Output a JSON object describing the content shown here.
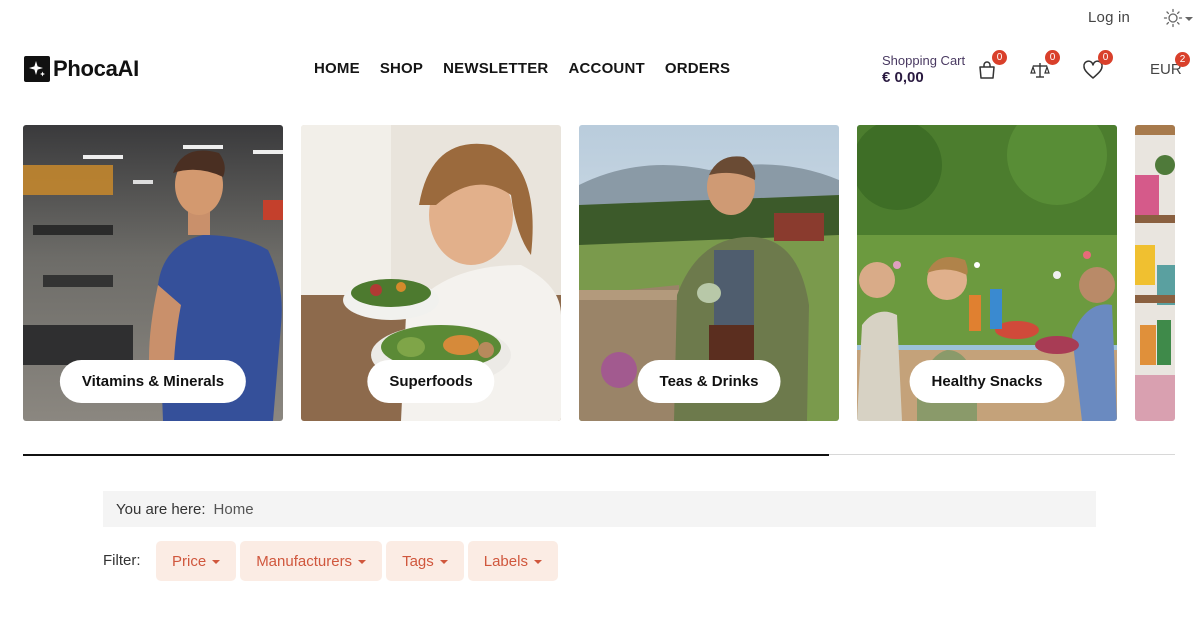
{
  "topbar": {
    "login_label": "Log in",
    "theme_icon": "sun-icon"
  },
  "logo": {
    "text": "PhocaAI",
    "icon": "sparkle-icon"
  },
  "nav": {
    "items": [
      "HOME",
      "SHOP",
      "NEWSLETTER",
      "ACCOUNT",
      "ORDERS"
    ]
  },
  "cart": {
    "label": "Shopping Cart",
    "total": "€ 0,00",
    "count": "0"
  },
  "compare": {
    "icon": "scale-icon",
    "count": "0"
  },
  "wishlist": {
    "icon": "heart-icon",
    "count": "0"
  },
  "currency": {
    "code": "EUR",
    "count": "2"
  },
  "categories": [
    {
      "label": "Vitamins & Minerals"
    },
    {
      "label": "Superfoods"
    },
    {
      "label": "Teas & Drinks"
    },
    {
      "label": "Healthy Snacks"
    }
  ],
  "slider": {
    "progress": 0.7
  },
  "breadcrumb": {
    "prefix": "You are here:",
    "home": "Home"
  },
  "filters": {
    "label": "Filter:",
    "buttons": [
      "Price",
      "Manufacturers",
      "Tags",
      "Labels"
    ]
  },
  "colors": {
    "accent": "#d0573d",
    "badge": "#d9402b",
    "filter_bg": "#fbece4"
  }
}
